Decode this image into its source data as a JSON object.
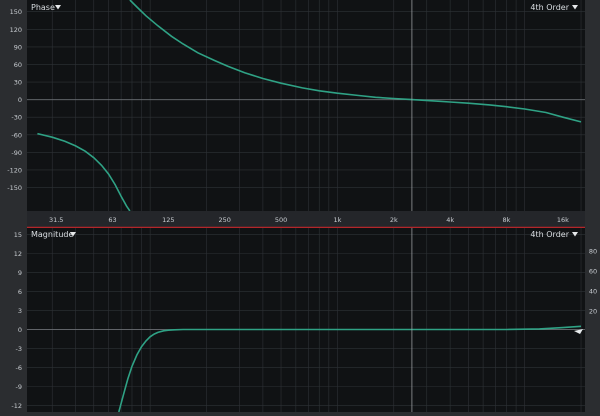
{
  "colors": {
    "background": "#2b2d30",
    "plot_bg": "#101214",
    "grid": "#2e3236",
    "zero_line": "#6b6f74",
    "curve": "#2fa285",
    "label": "#c9cdd2",
    "divider": "#b3262a"
  },
  "phase_panel": {
    "title": "Phase",
    "order_label": "4th Order",
    "dropdown_icon": "triangle-down-icon"
  },
  "magnitude_panel": {
    "title": "Magnitude",
    "order_label": "4th Order",
    "dropdown_icon": "triangle-down-icon"
  },
  "chart_data": [
    {
      "type": "line",
      "title": "Phase",
      "x_scale": "log",
      "xlim": [
        22,
        21000
      ],
      "ylim": [
        -190,
        170
      ],
      "x_ticks": [
        31.5,
        63,
        125,
        250,
        500,
        1000,
        2000,
        4000,
        8000,
        16000
      ],
      "x_tick_labels": [
        "31.5",
        "63",
        "125",
        "250",
        "500",
        "1k",
        "2k",
        "4k",
        "8k",
        "16k"
      ],
      "y_ticks": [
        150,
        120,
        90,
        60,
        30,
        0,
        -30,
        -60,
        -90,
        -120,
        -150
      ],
      "grid": true,
      "cursor_x": 2500,
      "series": [
        {
          "x": [
            25,
            30,
            35,
            40,
            45,
            50,
            55,
            60,
            65,
            70,
            75,
            78
          ],
          "y": [
            -58,
            -64,
            -71,
            -79,
            -88,
            -99,
            -112,
            -127,
            -145,
            -165,
            -182,
            -190
          ]
        },
        {
          "x": [
            78,
            85,
            95,
            110,
            130,
            150,
            180,
            220,
            260,
            320,
            400,
            500,
            650,
            800,
            1000,
            1300,
            1600,
            2000,
            2500,
            3200,
            4000,
            5000,
            6500,
            8000,
            10000,
            13000,
            16000,
            20000
          ],
          "y": [
            170,
            158,
            143,
            126,
            108,
            95,
            80,
            67,
            57,
            46,
            36,
            28,
            20,
            15,
            11,
            7,
            4,
            2,
            0,
            -2,
            -4,
            -6,
            -9,
            -12,
            -16,
            -22,
            -30,
            -38
          ]
        }
      ]
    },
    {
      "type": "line",
      "title": "Magnitude",
      "x_scale": "log",
      "xlim": [
        22,
        21000
      ],
      "ylim": [
        -13,
        16
      ],
      "y_ticks": [
        15,
        12,
        9,
        6,
        3,
        0,
        -3,
        -6,
        -9,
        -12
      ],
      "y2_ticks": [
        80,
        60,
        40,
        20
      ],
      "grid": true,
      "cursor_x": 2500,
      "series": [
        {
          "x": [
            68,
            72,
            76,
            80,
            85,
            90,
            95,
            100,
            105,
            110,
            118,
            125,
            135,
            150,
            180,
            250,
            500,
            1000,
            2000,
            4000,
            8000,
            12000,
            16000,
            20000
          ],
          "y": [
            -13,
            -10.3,
            -7.8,
            -5.8,
            -4.0,
            -2.7,
            -1.8,
            -1.15,
            -0.72,
            -0.45,
            -0.2,
            -0.1,
            -0.04,
            0,
            0,
            0,
            0,
            0,
            0,
            0,
            0,
            0.1,
            0.3,
            0.5
          ]
        }
      ]
    }
  ]
}
